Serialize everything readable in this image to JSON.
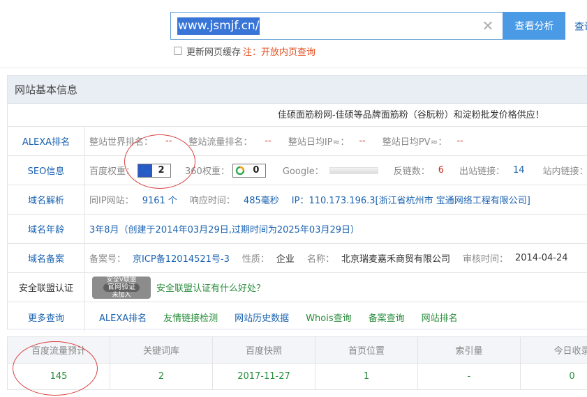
{
  "search": {
    "value": "www.jsmjf.cn/",
    "button_label": "查看分析",
    "side_link": "查询",
    "cache_label": "更新网页缓存",
    "cache_note": "注：开放内页查询"
  },
  "panel": {
    "title": "网站基本信息",
    "description": "佳硕面筋粉网-佳硕等品牌面筋粉（谷朊粉）和淀粉批发价格供应！",
    "alexa": {
      "label": "ALEXA排名",
      "world_rank_label": "整站世界排名：",
      "world_rank": "--",
      "traffic_rank_label": "整站流量排名：",
      "traffic_rank": "--",
      "daily_ip_label": "整站日均IP≈：",
      "daily_ip": "--",
      "daily_pv_label": "整站日均PV≈：",
      "daily_pv": "--"
    },
    "seo": {
      "label": "SEO信息",
      "baidu_label": "百度权重：",
      "baidu_weight": "2",
      "so360_label": "360权重：",
      "so360_weight": "0",
      "google_label": "Google：",
      "backlinks_label": "反链数：",
      "backlinks": "6",
      "outlinks_label": "出站链接：",
      "outlinks": "14",
      "inlinks_label": "站内链接："
    },
    "dns": {
      "label": "域名解析",
      "same_ip_label": "同IP网站：",
      "same_ip": "9161 个",
      "response_label": "响应时间：",
      "response": "485毫秒",
      "ip_label": "IP：",
      "ip": "110.173.196.3[浙江省杭州市 宝通网络工程有限公司]"
    },
    "age": {
      "label": "域名年龄",
      "value": "3年8月（创建于2014年03月29日,过期时间为2025年03月29日）"
    },
    "icp": {
      "label": "域名备案",
      "number_label": "备案号：",
      "number": "京ICP备12014521号-3",
      "type_label": "性质：",
      "type": "企业",
      "name_label": "名称：",
      "name": "北京瑞麦嘉禾商贸有限公司",
      "date_label": "审核时间：",
      "date": "2014-04-24"
    },
    "security": {
      "label": "安全联盟认证",
      "seal_top": "安全V联盟",
      "seal_main": "官网验证",
      "seal_sub": "未加入",
      "link": "安全联盟认证有什么好处？"
    },
    "more": {
      "label": "更多查询",
      "links": [
        "ALEXA排名",
        "友情链接检测",
        "网站历史数据",
        "Whois查询",
        "备案查询",
        "网站排名"
      ]
    }
  },
  "stats": {
    "headers": [
      "百度流量预计",
      "关键词库",
      "百度快照",
      "首页位置",
      "索引量",
      "今日收录"
    ],
    "values": [
      "145",
      "2",
      "2017-11-27",
      "1",
      "-",
      "0"
    ]
  },
  "colors": {
    "accent": "#4a9ae6",
    "link_blue": "#1a62b0",
    "value_green": "#2a8d3c",
    "value_red": "#cc2b1d",
    "annotation": "#d94040"
  }
}
